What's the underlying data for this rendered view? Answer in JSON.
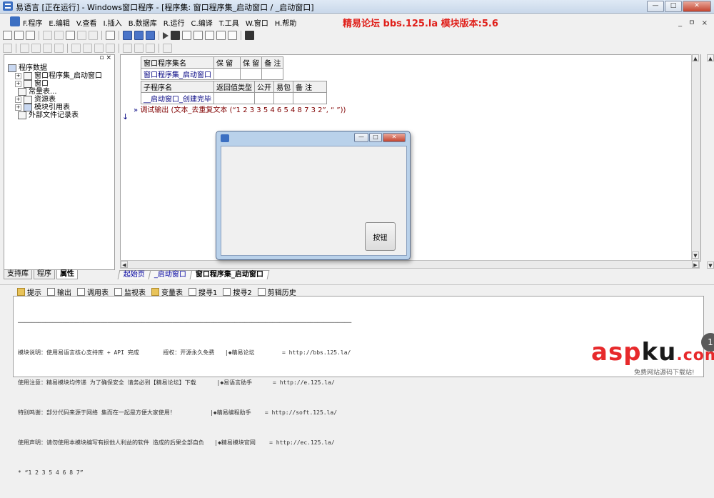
{
  "window": {
    "title": "易语言 [正在运行] - Windows窗口程序 - [程序集: 窗口程序集_启动窗口 / _启动窗口]",
    "controls": {
      "minimize": "—",
      "maximize": "□",
      "close": "✕"
    }
  },
  "menu": {
    "items": [
      "F.程序",
      "E.编辑",
      "V.查看",
      "I.插入",
      "B.数据库",
      "R.运行",
      "C.编译",
      "T.工具",
      "W.窗口",
      "H.帮助"
    ],
    "banner": "精易论坛 bbs.125.la 模块版本:5.6",
    "mdi_controls": "_ ㅁ ×"
  },
  "left_panel": {
    "pin": "▫ ×",
    "tree": [
      {
        "label": "程序数据",
        "level": 0,
        "expander": ""
      },
      {
        "label": "窗口程序集_启动窗口",
        "level": 1,
        "expander": "+"
      },
      {
        "label": "窗口",
        "level": 1,
        "expander": "+"
      },
      {
        "label": "常量表...",
        "level": 2,
        "expander": ""
      },
      {
        "label": "资源表",
        "level": 1,
        "expander": "+"
      },
      {
        "label": "模块引用表",
        "level": 1,
        "expander": "+"
      },
      {
        "label": "外部文件记录表",
        "level": 2,
        "expander": ""
      }
    ],
    "tabs": [
      "支持库",
      "程序",
      "属性"
    ]
  },
  "editor": {
    "assembly_table": {
      "headers": [
        "窗口程序集名",
        "保 留",
        "保 留",
        "备 注"
      ],
      "row": [
        "窗口程序集_启动窗口",
        "",
        "",
        ""
      ]
    },
    "sub_table": {
      "headers": [
        "子程序名",
        "返回值类型",
        "公开",
        "易包",
        "备 注"
      ],
      "row": [
        "__启动窗口_创建完毕",
        "",
        "",
        "",
        ""
      ]
    },
    "code_line": "调试输出 (文本_去重复文本 (“1 2 3 3 5 4 6 5 4 8 7 3 2”, “ ”))",
    "code_marker": "»",
    "down_marker": "↓",
    "tabs": [
      "起始页",
      "_启动窗口",
      "窗口程序集_启动窗口"
    ]
  },
  "output": {
    "tabs": [
      "提示",
      "输出",
      "调用表",
      "监视表",
      "变量表",
      "搜寻1",
      "搜寻2",
      "剪辑历史"
    ],
    "lines": [
      "模块说明：使用易语言核心支持库 + API 完成       授权：开源永久免费   |◆精易论坛        = http://bbs.125.la/",
      "使用注意：精易模块均传递 为了确保安全 请务必到【精易论坛】下载      |◆易语言助手      = http://e.125.la/",
      "特别鸣谢：部分代码来源于网络 集而在一起是方便大家使用！          |◆精易编程助手    = http://soft.125.la/",
      "使用声明：请勿使用本模块编写有损他人利益的软件 造成的后果全部自负   |◆精易模块官网    = http://ec.125.la/"
    ],
    "result": "* “1 2 3 5 4 6 8 7”"
  },
  "dialog": {
    "button_label": "按钮",
    "controls": {
      "minimize": "—",
      "maximize": "□",
      "close": "✕"
    }
  },
  "watermark": {
    "brand_left": "asp",
    "brand_mid": "ku",
    "brand_right": ".com",
    "sub": "免费网站源码下载站!",
    "circle": "1"
  }
}
